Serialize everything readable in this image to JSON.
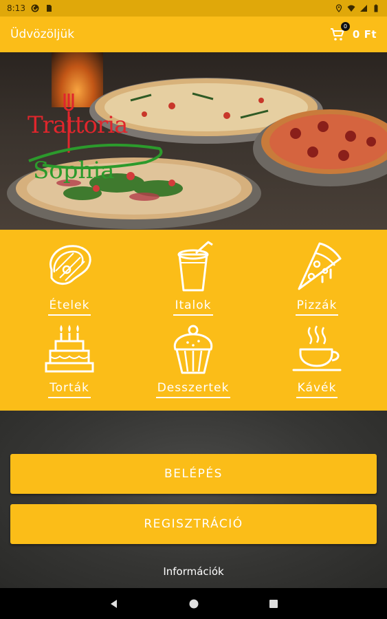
{
  "status_bar": {
    "time": "8:13",
    "icons": [
      "pocket-casts-icon",
      "sim-card-icon",
      "location-icon",
      "wifi-icon",
      "signal-icon",
      "battery-icon"
    ]
  },
  "app_bar": {
    "title": "Üdvözöljük",
    "cart_badge": "0",
    "cart_total": "0 Ft",
    "colors": {
      "app_bar": "#fbbd18"
    }
  },
  "hero": {
    "logo_line1": "Trattoria",
    "logo_line2": "Sophia"
  },
  "categories": [
    {
      "label": "Ételek",
      "icon": "steak-icon"
    },
    {
      "label": "Italok",
      "icon": "drink-cup-icon"
    },
    {
      "label": "Pizzák",
      "icon": "pizza-slice-icon"
    },
    {
      "label": "Torták",
      "icon": "cake-icon"
    },
    {
      "label": "Desszertek",
      "icon": "cupcake-icon"
    },
    {
      "label": "Kávék",
      "icon": "coffee-cup-icon"
    }
  ],
  "actions": {
    "login_label": "BELÉPÉS",
    "register_label": "REGISZTRÁCIÓ",
    "info_label": "Információk"
  },
  "nav_bar": {
    "icons": [
      "back-icon",
      "home-icon",
      "recents-icon"
    ]
  }
}
